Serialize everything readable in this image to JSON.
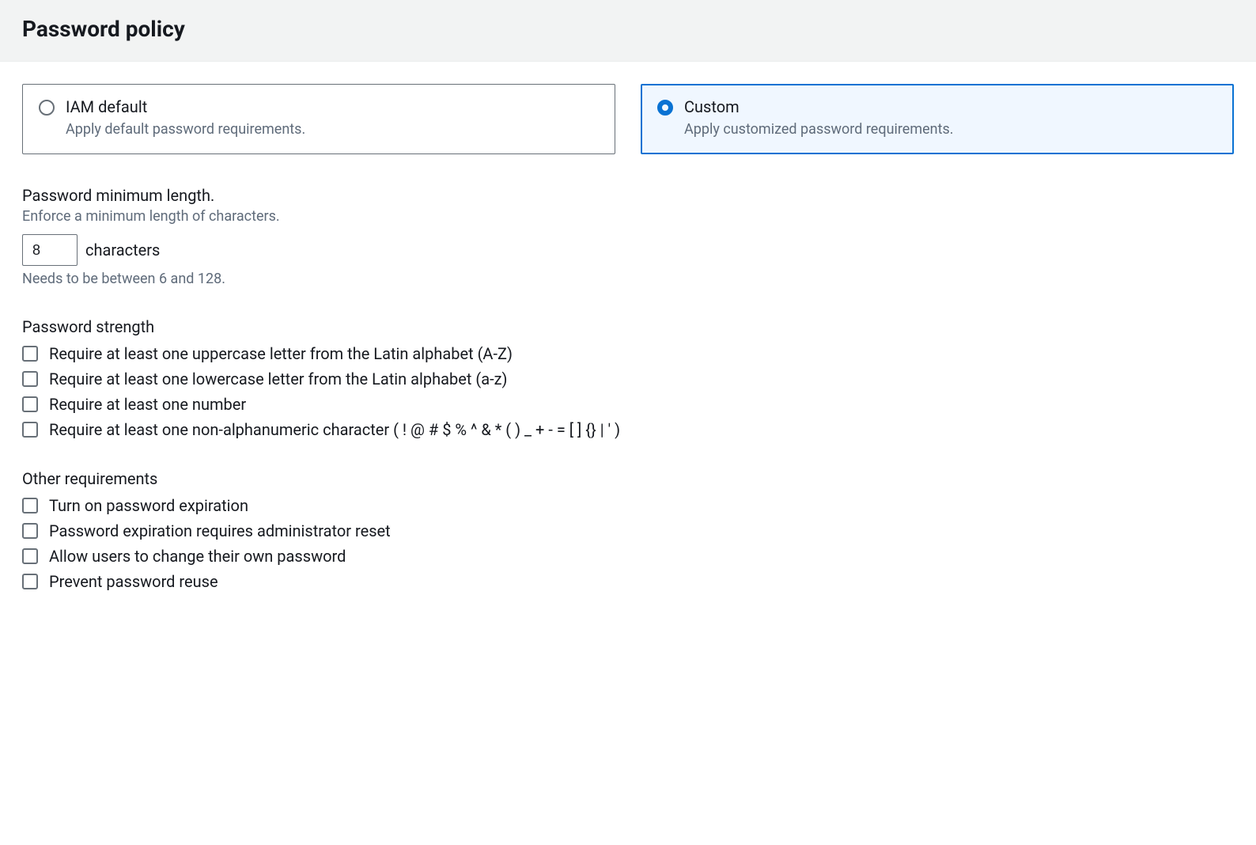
{
  "header": {
    "title": "Password policy"
  },
  "policyOptions": {
    "iamDefault": {
      "title": "IAM default",
      "desc": "Apply default password requirements."
    },
    "custom": {
      "title": "Custom",
      "desc": "Apply customized password requirements."
    }
  },
  "minLength": {
    "title": "Password minimum length.",
    "desc": "Enforce a minimum length of characters.",
    "value": "8",
    "unit": "characters",
    "hint": "Needs to be between 6 and 128."
  },
  "strength": {
    "title": "Password strength",
    "items": [
      "Require at least one uppercase letter from the Latin alphabet (A-Z)",
      "Require at least one lowercase letter from the Latin alphabet (a-z)",
      "Require at least one number",
      "Require at least one non-alphanumeric character ( ! @ # $ % ^ & * ( ) _ + - = [ ] {} | ' )"
    ]
  },
  "other": {
    "title": "Other requirements",
    "items": [
      "Turn on password expiration",
      "Password expiration requires administrator reset",
      "Allow users to change their own password",
      "Prevent password reuse"
    ]
  }
}
